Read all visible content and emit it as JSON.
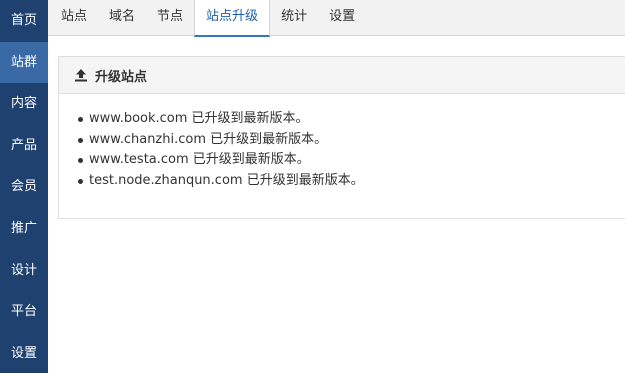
{
  "sidebar": {
    "items": [
      {
        "label": "首页",
        "active": false
      },
      {
        "label": "站群",
        "active": true
      },
      {
        "label": "内容",
        "active": false
      },
      {
        "label": "产品",
        "active": false
      },
      {
        "label": "会员",
        "active": false
      },
      {
        "label": "推广",
        "active": false
      },
      {
        "label": "设计",
        "active": false
      },
      {
        "label": "平台",
        "active": false
      },
      {
        "label": "设置",
        "active": false
      }
    ]
  },
  "tabs": [
    {
      "label": "站点",
      "active": false
    },
    {
      "label": "域名",
      "active": false
    },
    {
      "label": "节点",
      "active": false
    },
    {
      "label": "站点升级",
      "active": true
    },
    {
      "label": "统计",
      "active": false
    },
    {
      "label": "设置",
      "active": false
    }
  ],
  "panel": {
    "icon": "upload-icon",
    "title": "升级站点",
    "results": [
      "www.book.com 已升级到最新版本。",
      "www.chanzhi.com 已升级到最新版本。",
      "www.testa.com 已升级到最新版本。",
      "test.node.zhanqun.com 已升级到最新版本。"
    ]
  },
  "colors": {
    "sidebar_bg": "#1f4170",
    "sidebar_active": "#3a6aa6",
    "tab_active_text": "#1a5fa8",
    "tab_active_border": "#2f78c2"
  }
}
